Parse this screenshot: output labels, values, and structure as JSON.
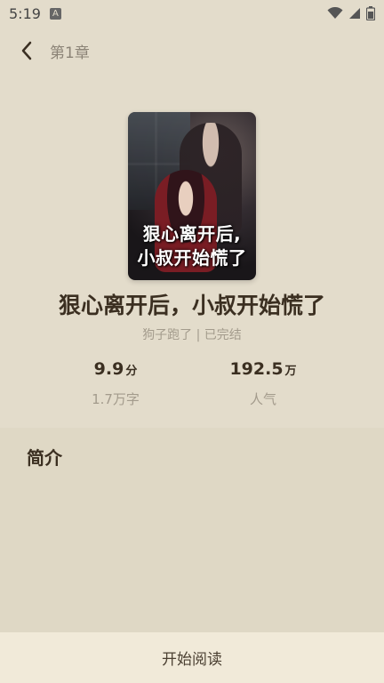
{
  "status_bar": {
    "time": "5:19",
    "app_icon_letter": "A",
    "icons": [
      "wifi-icon",
      "signal-icon",
      "battery-icon"
    ]
  },
  "header": {
    "back_icon": "chevron-left-icon",
    "chapter_title": "第1章"
  },
  "book": {
    "cover_text_line1": "狠心离开后,",
    "cover_text_line2": "小叔开始慌了",
    "title": "狠心离开后，小叔开始慌了",
    "meta": "狗子跑了 | 已完结"
  },
  "stats": {
    "rating_value": "9.9",
    "rating_unit": "分",
    "word_count": "1.7万字",
    "popularity_value": "192.5",
    "popularity_unit": "万",
    "popularity_label": "人气"
  },
  "intro": {
    "heading": "简介"
  },
  "footer": {
    "start_reading_label": "开始阅读"
  },
  "colors": {
    "background": "#e3dccb",
    "panel": "#dfd8c5",
    "bottom_bar": "#f1ead9",
    "title_text": "#3b2f21",
    "secondary_text": "#a39b8c"
  }
}
